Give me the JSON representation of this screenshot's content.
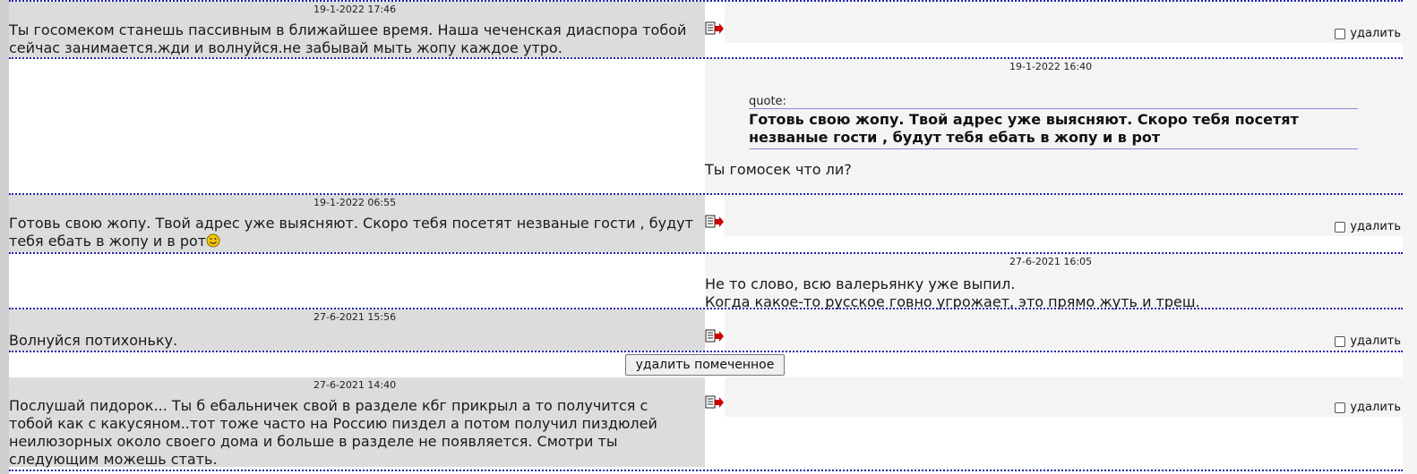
{
  "messages": [
    {
      "timestamp": "19-1-2022 17:46",
      "side": "incoming",
      "text": "Ты госомеком станешь пассивным в ближайшее время. Наша чеченская диаспора тобой сейчас занимается.жди и волнуйся.не забывай мыть жопу каждое утро.",
      "delete_label": "удалить"
    },
    {
      "timestamp": "19-1-2022 16:40",
      "side": "outgoing",
      "quote_label": "quote:",
      "quote_text": "Готовь свою жопу. Твой адрес уже выясняют. Скоро тебя посетят незваные гости , будут тебя ебать в жопу и в рот",
      "text": "Ты гомосек что ли?"
    },
    {
      "timestamp": "19-1-2022 06:55",
      "side": "incoming",
      "text_line1": "Готовь свою жопу. Твой адрес уже выясняют. Скоро тебя посетят незваные гости , будут",
      "text_line2": "тебя ебать в жопу и в рот",
      "delete_label": "удалить"
    },
    {
      "timestamp": "27-6-2021 16:05",
      "side": "outgoing",
      "text_line1": "Не то слово, всю валерьянку уже выпил.",
      "text_line2": "Когда какое-то русское говно угрожает, это прямо жуть и треш."
    },
    {
      "timestamp": "27-6-2021 15:56",
      "side": "incoming",
      "text": "Волнуйся потихоньку.",
      "delete_label": "удалить"
    },
    {
      "timestamp": "27-6-2021 14:40",
      "side": "incoming",
      "text": "Послушай пидорок... Ты б ебальничек свой в разделе кбг прикрыл а то получится с тобой как с какусяном..тот тоже часто на Россию пиздел а потом получил пиздюлей неилюзорных около своего дома и больше в разделе не появляется. Смотри ты следующим можешь стать.",
      "delete_label": "удалить"
    }
  ],
  "bulk_delete_label": "удалить помеченное",
  "icons": {
    "reply": "reply-arrow-icon",
    "smiley": "smiley-icon",
    "checkbox": "checkbox"
  },
  "colors": {
    "incoming_bg": "#dcdcdc",
    "outgoing_bg": "#f4f4f4",
    "separator": "#2222aa",
    "reply_arrow": "#cc0000"
  }
}
